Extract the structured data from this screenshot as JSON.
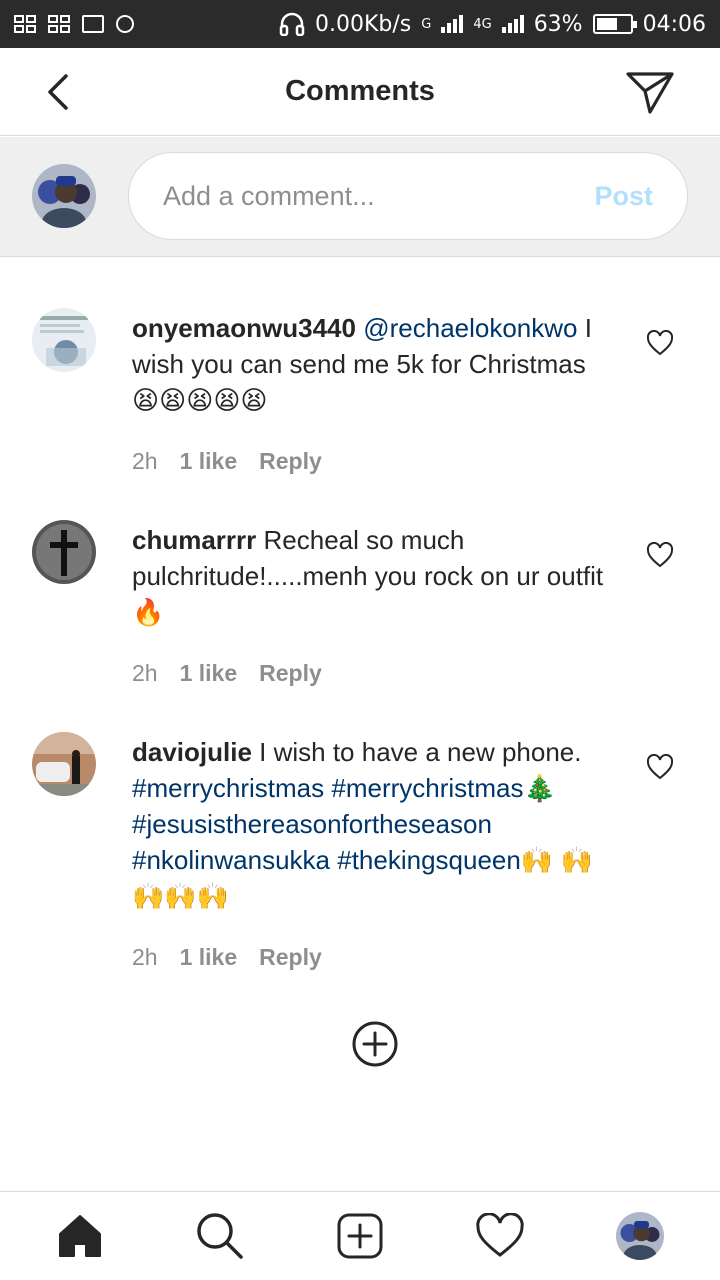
{
  "status_bar": {
    "speed": "0.00Kb/s",
    "sim1": "G",
    "sim2": "4G",
    "battery_percent": "63%",
    "battery_level": 0.63,
    "time": "04:06"
  },
  "header": {
    "title": "Comments",
    "back_icon": "chevron-left-icon",
    "share_icon": "paper-plane-icon"
  },
  "compose": {
    "placeholder": "Add a comment...",
    "post_label": "Post",
    "post_color": "#b2dffc"
  },
  "comments": [
    {
      "username": "onyemaonwu3440",
      "mention": "@rechaelokonkwo",
      "text": " I wish you can send me 5k for Christmas😫😫😫😫😫",
      "time": "2h",
      "likes": "1 like",
      "reply": "Reply"
    },
    {
      "username": "chumarrrr",
      "text": " Recheal so much pulchritude!.....menh you rock on ur outfit🔥",
      "time": "2h",
      "likes": "1 like",
      "reply": "Reply"
    },
    {
      "username": "daviojulie",
      "text": " I wish to have a new phone. ",
      "tags": [
        "#merrychristmas",
        "#merrychristmas",
        "#jesusisthereasonfortheseason",
        "#nkolinwansukka",
        "#thekingsqueen"
      ],
      "emoji_after_tag2": "🎄",
      "emoji_end": "🙌 🙌🙌🙌🙌",
      "time": "2h",
      "likes": "1 like",
      "reply": "Reply"
    }
  ],
  "colors": {
    "link": "#003569",
    "secondary_text": "#8e8e8e",
    "divider": "#dbdbdb",
    "status_bar_bg": "#2b2b2b"
  }
}
